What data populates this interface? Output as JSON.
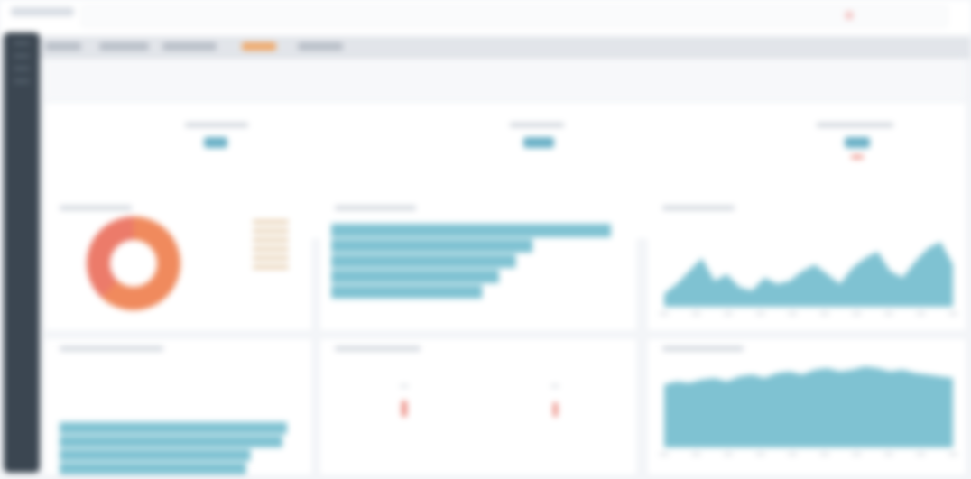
{
  "app": {
    "title": "",
    "search_placeholder": ""
  },
  "tabs": [
    {
      "label": "",
      "active": false
    },
    {
      "label": "",
      "active": false
    },
    {
      "label": "",
      "active": false
    },
    {
      "label": "",
      "active": true
    },
    {
      "label": "",
      "active": false
    }
  ],
  "kpis": [
    {
      "label": "",
      "value": "",
      "trend": ""
    },
    {
      "label": "",
      "value": "",
      "trend": ""
    },
    {
      "label": "",
      "value": "",
      "trend": ""
    }
  ],
  "panels": {
    "donut": {
      "title": "",
      "legend": [
        "",
        "",
        "",
        "",
        "",
        ""
      ]
    },
    "bars": {
      "title": ""
    },
    "area1": {
      "title": ""
    },
    "bars2": {
      "title": ""
    },
    "markers": {
      "title": ""
    },
    "area2": {
      "title": ""
    }
  },
  "colors": {
    "accent": "#7fc2d2",
    "orange": "#f08a5d",
    "coral": "#ec7b6a",
    "active_tab": "#f0a868",
    "sidebar": "#3b4651"
  },
  "chart_data": [
    {
      "type": "pie",
      "title": "",
      "values": [
        62,
        38
      ],
      "colors": [
        "#f08a5d",
        "#ec7b6a"
      ]
    },
    {
      "type": "bar",
      "title": "",
      "orientation": "horizontal",
      "values": [
        100,
        72,
        66,
        60,
        54
      ],
      "ylim": [
        0,
        100
      ]
    },
    {
      "type": "area",
      "title": "",
      "values": [
        8,
        14,
        22,
        30,
        16,
        20,
        12,
        10,
        18,
        14,
        16,
        22,
        26,
        20,
        14,
        24,
        30,
        34,
        22,
        18,
        28,
        36,
        40,
        26
      ],
      "ylim": [
        0,
        50
      ]
    },
    {
      "type": "bar",
      "title": "",
      "orientation": "horizontal",
      "values": [
        100,
        98,
        84,
        82,
        74,
        70
      ],
      "ylim": [
        0,
        100
      ]
    },
    {
      "type": "area",
      "title": "",
      "values": [
        38,
        40,
        39,
        41,
        42,
        40,
        43,
        44,
        42,
        45,
        46,
        44,
        47,
        48,
        46,
        47,
        49,
        48,
        46,
        47,
        45,
        44,
        43,
        42
      ],
      "ylim": [
        0,
        60
      ]
    }
  ]
}
